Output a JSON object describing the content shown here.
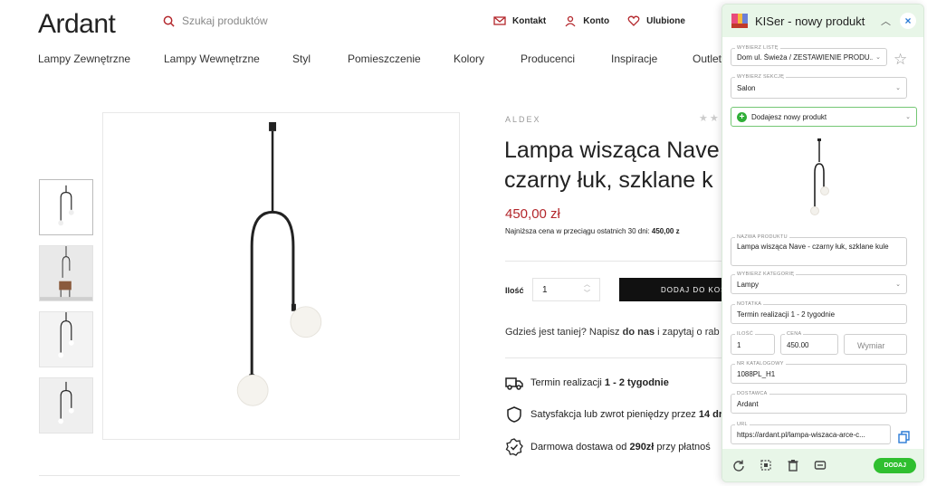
{
  "store": {
    "logo": "Ardant",
    "search_placeholder": "Szukaj produktów",
    "top_links": [
      "Kontakt",
      "Konto",
      "Ulubione"
    ],
    "nav": [
      "Lampy Zewnętrzne",
      "Lampy Wewnętrzne",
      "Styl",
      "Pomieszczenie",
      "Kolory",
      "Producenci",
      "Inspiracje",
      "Outlet"
    ]
  },
  "product": {
    "brand": "ALDEX",
    "title_line1": "Lampa wisząca Nave",
    "title_line2": "czarny łuk, szklane k",
    "price": "450,00 zł",
    "lowest_prefix": "Najniższa cena w przeciągu ostatnich 30 dni: ",
    "lowest_value": "450,00 z",
    "qty_label": "Ilość",
    "qty_value": "1",
    "add_button": "DODAJ DO KOSZ",
    "cheaper_prefix": "Gdzieś jest taniej? Napisz ",
    "cheaper_bold": "do nas",
    "cheaper_suffix": " i zapytaj o rab",
    "feature1_prefix": "Termin realizacji ",
    "feature1_bold": "1 - 2 tygodnie",
    "feature2_prefix": "Satysfakcja lub zwrot pieniędzy przez ",
    "feature2_bold": "14 dr",
    "feature3_prefix": "Darmowa dostawa od ",
    "feature3_bold": "290zł",
    "feature3_suffix": " przy płatnoś"
  },
  "panel": {
    "title": "KISer - nowy produkt",
    "list_label": "WYBIERZ LISTĘ",
    "list_value": "Dom ul. Świeża / ZESTAWIENIE PRODU...",
    "section_label": "WYBIERZ SEKCJĘ",
    "section_value": "Salon",
    "adding_text": "Dodajesz nowy produkt",
    "name_label": "NAZWA PRODUKTU",
    "name_value": "Lampa wisząca Nave - czarny łuk, szklane kule",
    "category_label": "WYBIERZ KATEGORIĘ",
    "category_value": "Lampy",
    "note_label": "NOTATKA",
    "note_value": "Termin realizacji 1 - 2 tygodnie",
    "qty_label": "ILOŚĆ",
    "qty_value": "1",
    "price_label": "CENA",
    "price_value": "450.00",
    "dimension_placeholder": "Wymiar",
    "catalog_label": "NR KATALOGOWY",
    "catalog_value": "1088PL_H1",
    "supplier_label": "DOSTAWCA",
    "supplier_value": "Ardant",
    "url_label": "URL",
    "url_value": "https://ardant.pl/lampa-wiszaca-arce-c...",
    "submit": "DODAJ"
  },
  "colors": {
    "price": "#b3262b",
    "accent_green": "#2fbf2f",
    "panel_bg": "#e8f6e8"
  }
}
